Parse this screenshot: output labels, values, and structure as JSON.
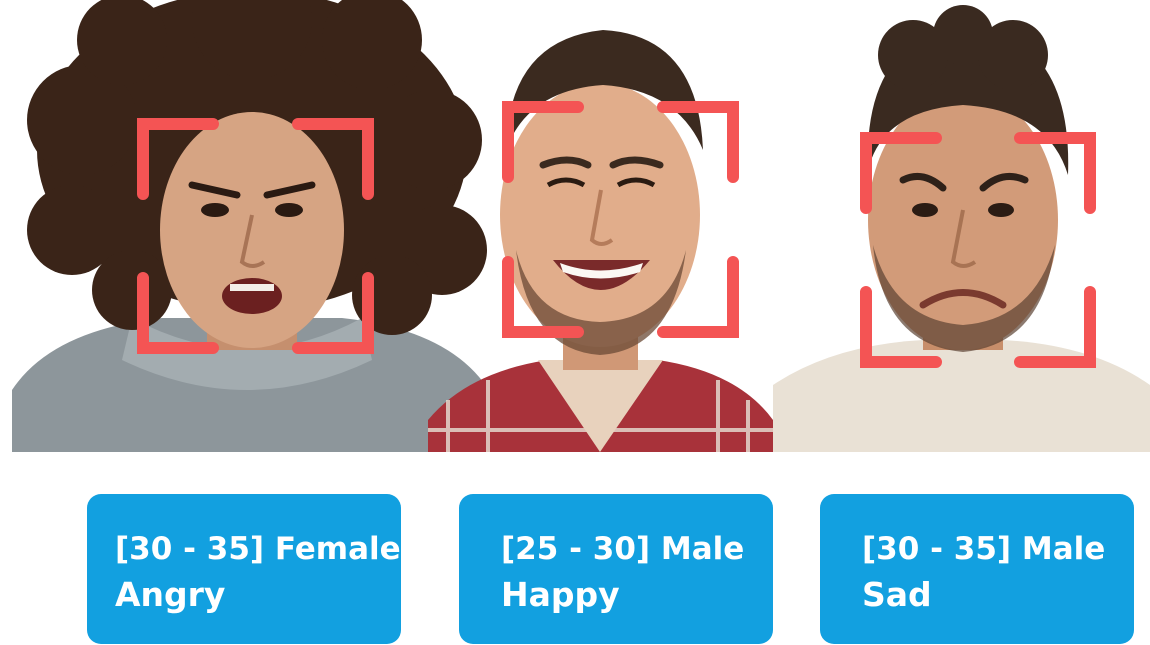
{
  "accent_color": "#12a0e0",
  "frame_color": "#f45454",
  "faces": [
    {
      "demographic": "[30 - 35] Female",
      "emotion": "Angry",
      "illustration": "curly-haired-woman-angry-face"
    },
    {
      "demographic": "[25 - 30] Male",
      "emotion": "Happy",
      "illustration": "smiling-man-plaid-shirt"
    },
    {
      "demographic": "[30 - 35] Male",
      "emotion": "Sad",
      "illustration": "sad-man-beige-sweater"
    }
  ]
}
